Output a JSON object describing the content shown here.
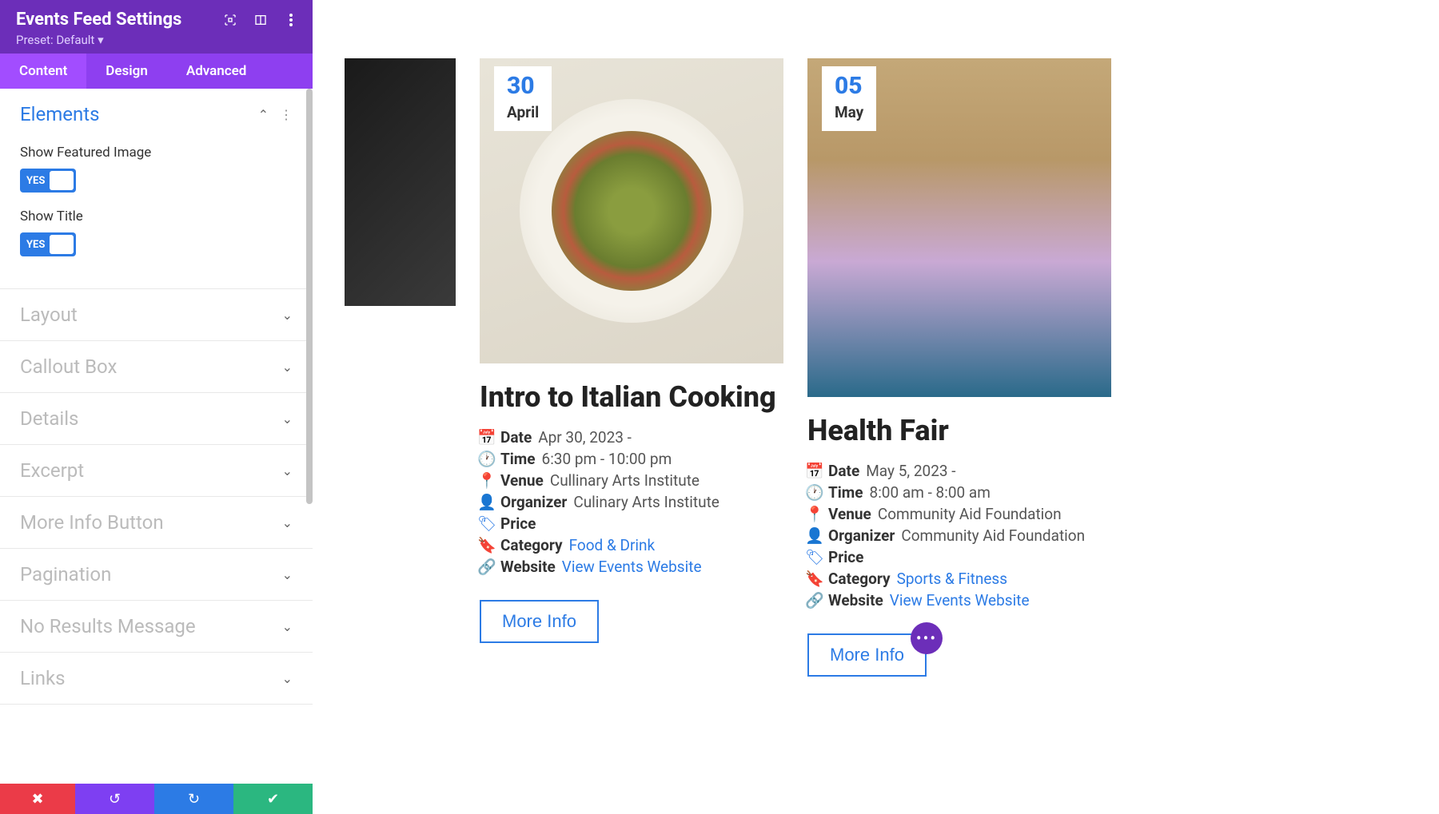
{
  "sidebar": {
    "title": "Events Feed Settings",
    "preset_label": "Preset: Default",
    "tabs": [
      "Content",
      "Design",
      "Advanced"
    ],
    "active_tab": 0,
    "sections": {
      "elements": {
        "title": "Elements",
        "open": true,
        "toggles": [
          {
            "label": "Show Featured Image",
            "value": "YES"
          },
          {
            "label": "Show Title",
            "value": "YES"
          }
        ]
      },
      "collapsed": [
        "Layout",
        "Callout Box",
        "Details",
        "Excerpt",
        "More Info Button",
        "Pagination",
        "No Results Message",
        "Links"
      ]
    }
  },
  "events": [
    {
      "badge_day": "30",
      "badge_month": "April",
      "title": "Intro to Italian Cooking",
      "details": {
        "date_label": "Date",
        "date_value": "Apr 30, 2023 -",
        "time_label": "Time",
        "time_value": "6:30 pm - 10:00 pm",
        "venue_label": "Venue",
        "venue_value": "Cullinary Arts Institute",
        "organizer_label": "Organizer",
        "organizer_value": "Culinary Arts Institute",
        "price_label": "Price",
        "price_value": "",
        "category_label": "Category",
        "category_link": "Food & Drink",
        "website_label": "Website",
        "website_link": "View Events Website"
      },
      "button": "More Info"
    },
    {
      "badge_day": "05",
      "badge_month": "May",
      "title": "Health Fair",
      "details": {
        "date_label": "Date",
        "date_value": "May 5, 2023 -",
        "time_label": "Time",
        "time_value": "8:00 am - 8:00 am",
        "venue_label": "Venue",
        "venue_value": "Community Aid Foundation",
        "organizer_label": "Organizer",
        "organizer_value": "Community Aid Foundation",
        "price_label": "Price",
        "price_value": "",
        "category_label": "Category",
        "category_link": "Sports & Fitness",
        "website_label": "Website",
        "website_link": "View Events Website"
      },
      "button": "More Info"
    }
  ],
  "colors": {
    "accent": "#2c7be5",
    "purple": "#6c2eb9"
  }
}
